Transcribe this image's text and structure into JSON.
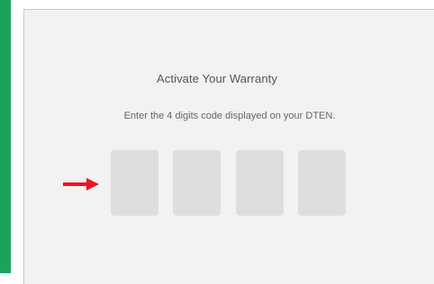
{
  "dialog": {
    "title": "Activate Your Warranty",
    "instructions": "Enter the 4 digits code displayed on your DTEN."
  },
  "code_inputs": [
    {
      "value": "",
      "placeholder": ""
    },
    {
      "value": "",
      "placeholder": ""
    },
    {
      "value": "",
      "placeholder": ""
    },
    {
      "value": "",
      "placeholder": ""
    }
  ],
  "colors": {
    "accent_strip": "#1aa35b",
    "arrow": "#e8171f",
    "panel_bg": "#f2f2f2",
    "code_box_bg": "#dedede"
  },
  "icons": {
    "pointer": "right-arrow-icon"
  }
}
